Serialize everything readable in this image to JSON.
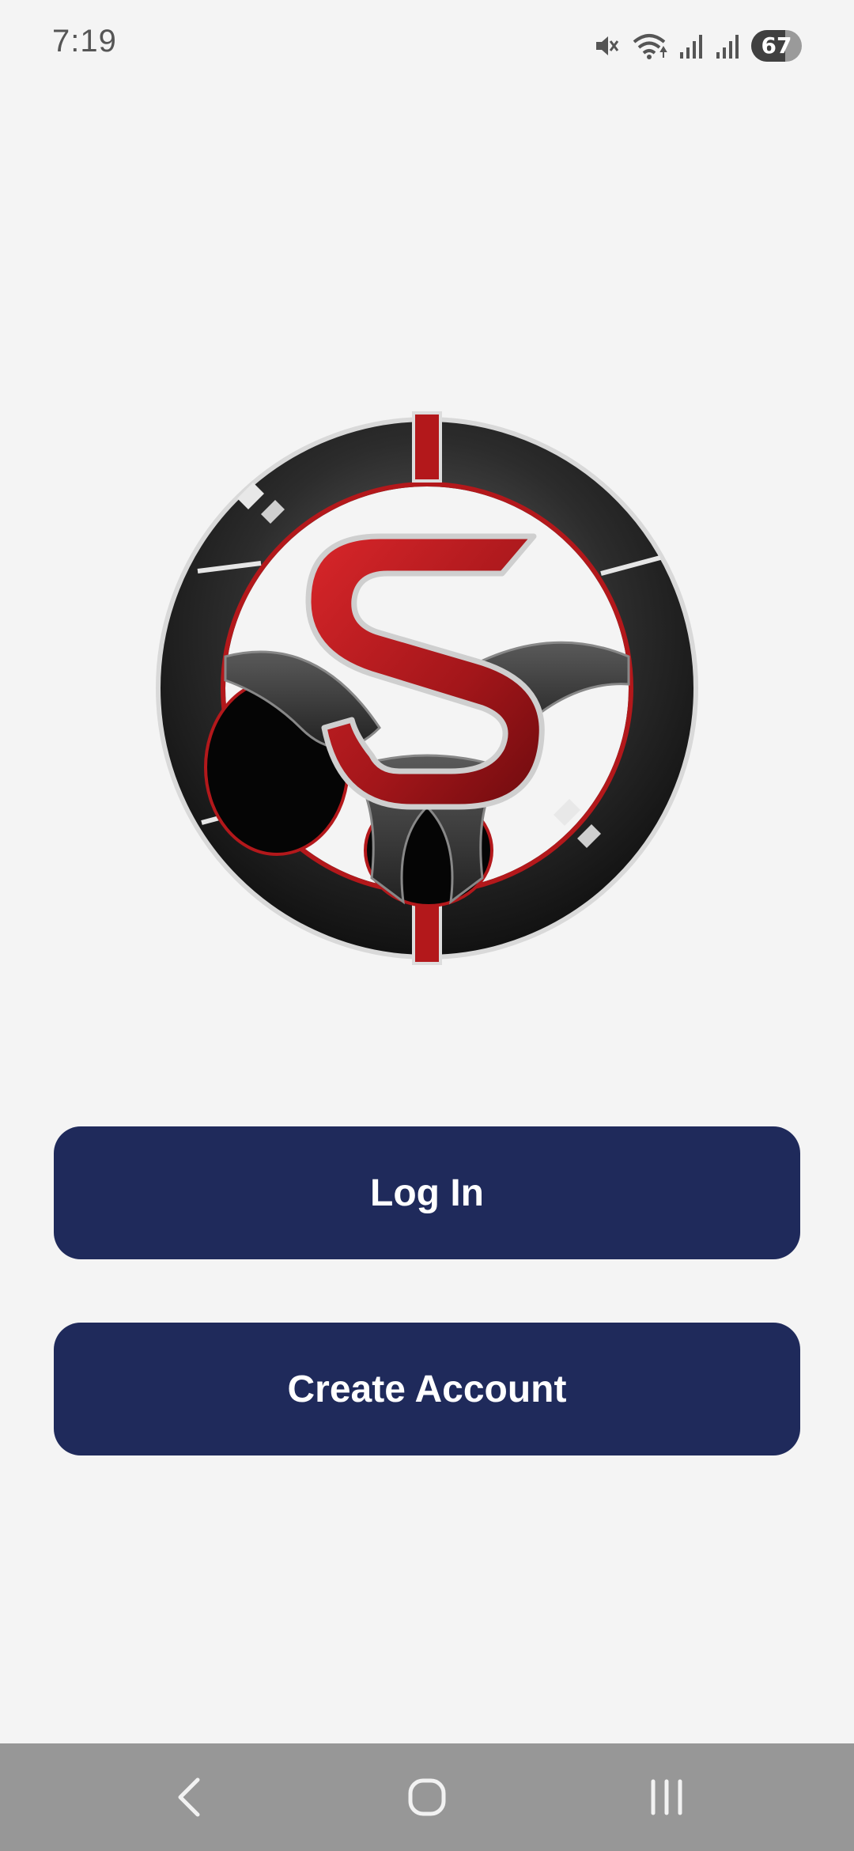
{
  "status_bar": {
    "time": "7:19",
    "battery_level": "67",
    "icons": [
      "mute-icon",
      "wifi-icon",
      "signal-icon",
      "signal-icon",
      "battery-icon"
    ]
  },
  "logo": {
    "icon": "steering-wheel-logo",
    "colors": {
      "rim": "#2a2a2a",
      "accent": "#b3181b",
      "chrome": "#c9c9c9"
    }
  },
  "actions": {
    "login_label": "Log In",
    "create_account_label": "Create Account"
  },
  "navigation": {
    "icons": [
      "back-icon",
      "home-icon",
      "recent-apps-icon"
    ]
  },
  "colors": {
    "background": "#f4f4f4",
    "button": "#1f2a5b",
    "button_text": "#ffffff",
    "nav_bar": "#979797"
  }
}
